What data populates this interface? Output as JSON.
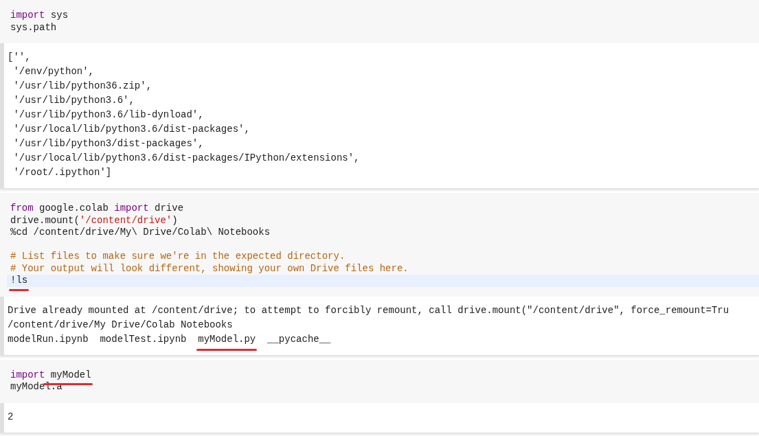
{
  "cells": [
    {
      "code": [
        [
          {
            "text": "import",
            "kind": "keyword"
          },
          {
            "text": " sys",
            "kind": "plain"
          }
        ],
        [
          {
            "text": "sys.path",
            "kind": "plain"
          }
        ]
      ],
      "output": [
        [
          {
            "text": "['',"
          }
        ],
        [
          {
            "text": " '/env/python',"
          }
        ],
        [
          {
            "text": " '/usr/lib/python36.zip',"
          }
        ],
        [
          {
            "text": " '/usr/lib/python3.6',"
          }
        ],
        [
          {
            "text": " '/usr/lib/python3.6/lib-dynload',"
          }
        ],
        [
          {
            "text": " '/usr/local/lib/python3.6/dist-packages',"
          }
        ],
        [
          {
            "text": " '/usr/lib/python3/dist-packages',"
          }
        ],
        [
          {
            "text": " '/usr/local/lib/python3.6/dist-packages/IPython/extensions',"
          }
        ],
        [
          {
            "text": " '/root/.ipython']"
          }
        ]
      ]
    },
    {
      "code": [
        [
          {
            "text": "from",
            "kind": "keyword"
          },
          {
            "text": " google.colab ",
            "kind": "plain"
          },
          {
            "text": "import",
            "kind": "keyword"
          },
          {
            "text": " drive",
            "kind": "plain"
          }
        ],
        [
          {
            "text": "drive.mount(",
            "kind": "plain"
          },
          {
            "text": "'/content/drive'",
            "kind": "string"
          },
          {
            "text": ")",
            "kind": "plain"
          }
        ],
        [
          {
            "text": "%cd /content/drive/My\\ Drive/Colab\\ Notebooks",
            "kind": "plain"
          }
        ],
        {
          "kind": "blank"
        },
        [
          {
            "text": "# List files to make sure we're in the expected directory.",
            "kind": "comment"
          }
        ],
        [
          {
            "text": "# Your output will look different, showing your own Drive files here.",
            "kind": "comment"
          }
        ],
        {
          "kind": "code",
          "highlighted": true,
          "tokens": [
            {
              "text": "!ls",
              "kind": "plain",
              "underlined": true
            }
          ]
        }
      ],
      "output": [
        [
          {
            "text": "Drive already mounted at /content/drive; to attempt to forcibly remount, call drive.mount(\"/content/drive\", force_remount=Tru"
          }
        ],
        [
          {
            "text": "/content/drive/My Drive/Colab Notebooks"
          }
        ],
        [
          {
            "text": "modelRun.ipynb  modelTest.ipynb  "
          },
          {
            "text": "myModel.py",
            "underlined": true
          },
          {
            "text": "  __pycache__"
          }
        ]
      ]
    },
    {
      "code": [
        [
          {
            "text": "import",
            "kind": "keyword"
          },
          {
            "text": " myModel",
            "kind": "plain",
            "underlined": true
          }
        ],
        [
          {
            "text": "myModel.a",
            "kind": "plain"
          }
        ]
      ],
      "output": [
        [
          {
            "text": "2"
          }
        ]
      ]
    }
  ]
}
